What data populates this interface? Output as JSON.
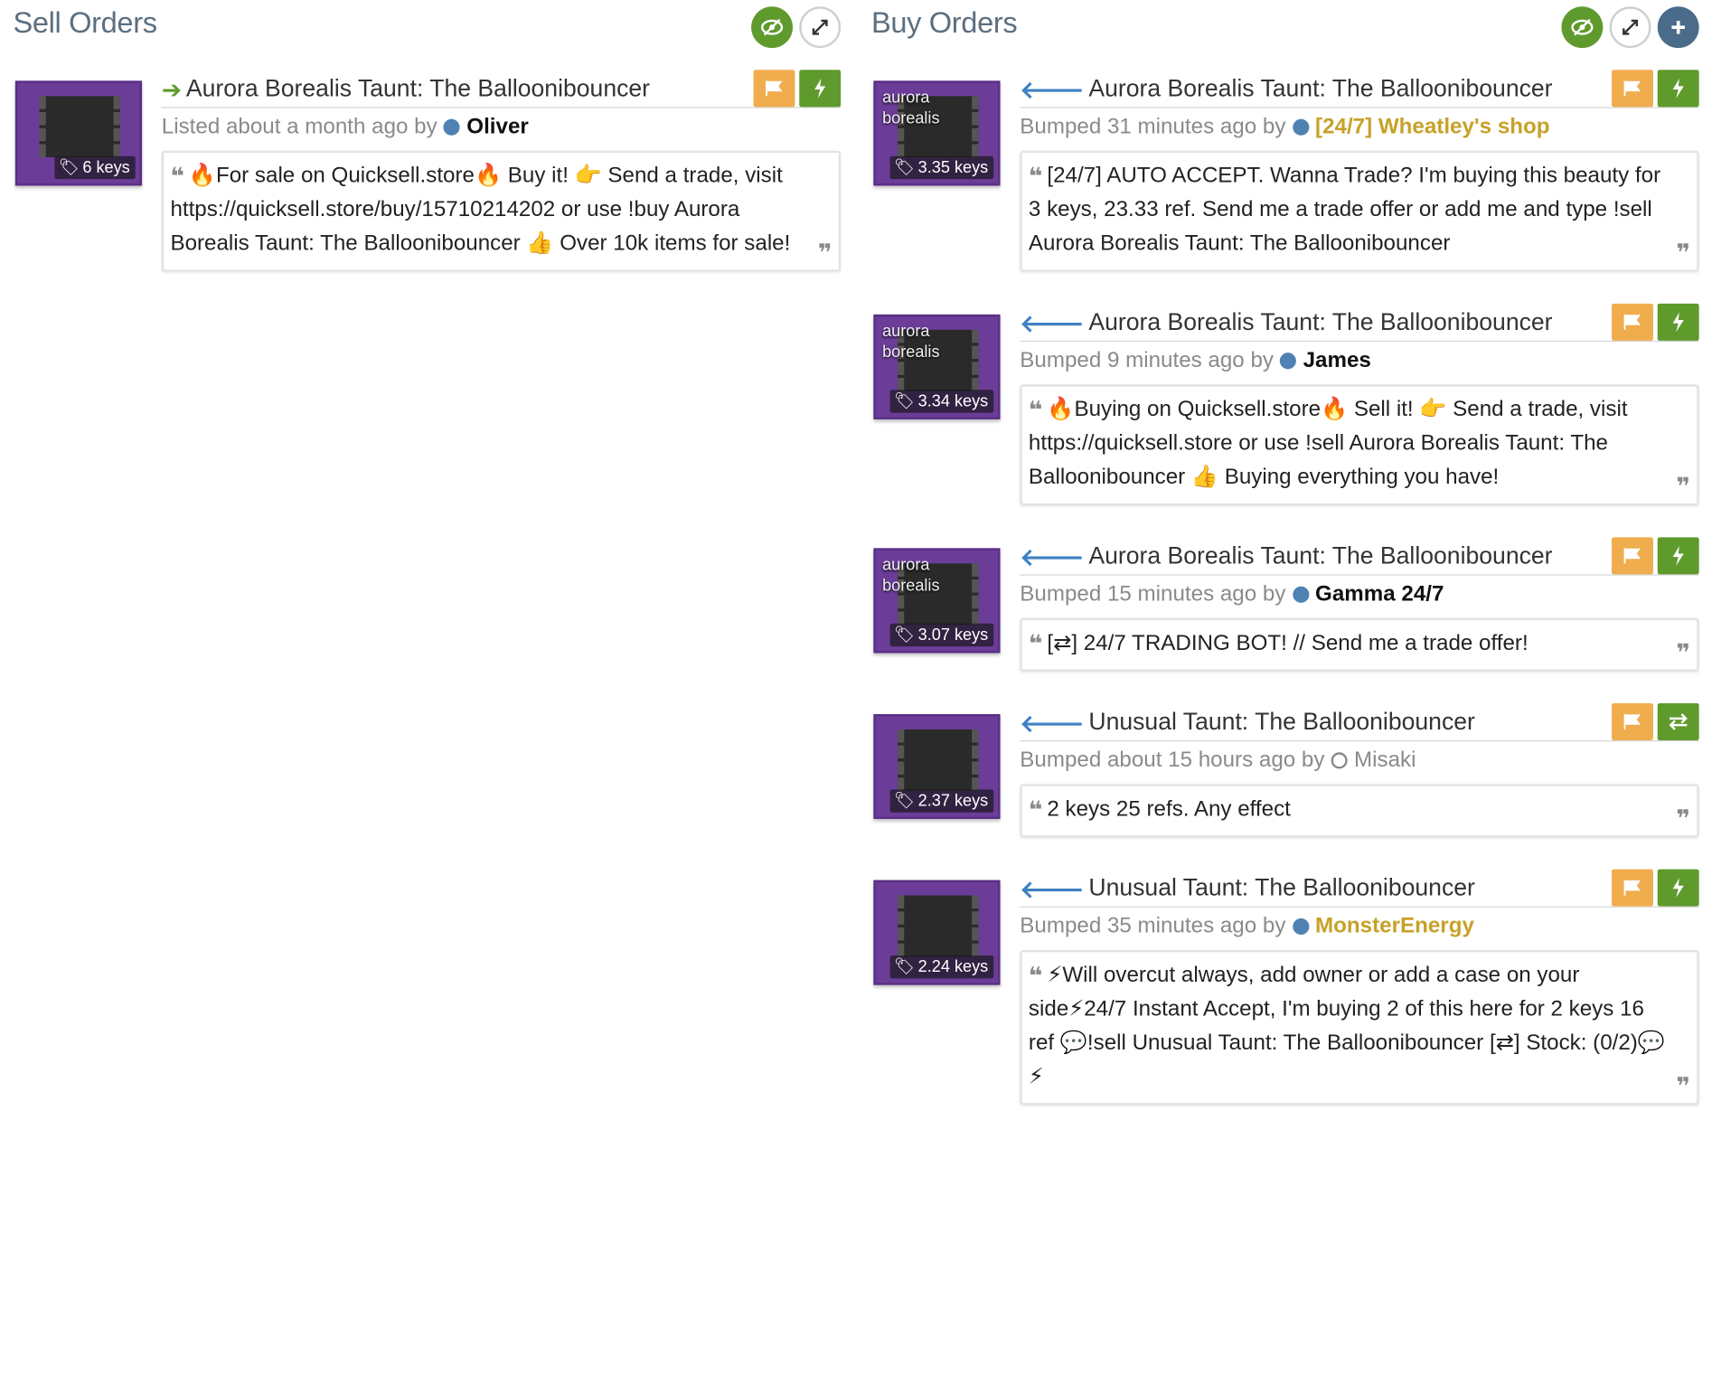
{
  "sell": {
    "title": "Sell Orders",
    "listings": [
      {
        "name": "Aurora Borealis Taunt: The Balloonibouncer",
        "price": "6 keys",
        "meta_prefix": "Listed about a month ago by",
        "user": "Oliver",
        "message": "🔥For sale on Quicksell.store🔥 Buy it! 👉 Send a trade, visit https://quicksell.store/buy/15710214202 or use !buy Aurora Borealis Taunt: The Balloonibouncer 👍 Over 10k items for sale!"
      }
    ]
  },
  "buy": {
    "title": "Buy Orders",
    "listings": [
      {
        "name": "Aurora Borealis Taunt: The Balloonibouncer",
        "overlay": "aurora borealis",
        "price": "3.35 keys",
        "meta_prefix": "Bumped 31 minutes ago by",
        "user": "[24/7] Wheatley's shop",
        "message": "[24/7] AUTO ACCEPT. Wanna Trade? I'm buying this beauty for 3 keys, 23.33 ref. Send me a trade offer or add me and type !sell Aurora Borealis Taunt: The Balloonibouncer"
      },
      {
        "name": "Aurora Borealis Taunt: The Balloonibouncer",
        "overlay": "aurora borealis",
        "price": "3.34 keys",
        "meta_prefix": "Bumped 9 minutes ago by",
        "user": "James",
        "message": "🔥Buying on Quicksell.store🔥 Sell it! 👉 Send a trade, visit https://quicksell.store or use !sell Aurora Borealis Taunt: The Balloonibouncer 👍 Buying everything you have!"
      },
      {
        "name": "Aurora Borealis Taunt: The Balloonibouncer",
        "overlay": "aurora borealis",
        "price": "3.07 keys",
        "meta_prefix": "Bumped 15 minutes ago by",
        "user": "Gamma 24/7",
        "message": "[⇄] 24/7 TRADING BOT! // Send me a trade offer!"
      },
      {
        "name": "Unusual Taunt: The Balloonibouncer",
        "price": "2.37 keys",
        "meta_prefix": "Bumped about 15 hours ago by",
        "user": "Misaki",
        "message": "2 keys 25 refs. Any effect"
      },
      {
        "name": "Unusual Taunt: The Balloonibouncer",
        "price": "2.24 keys",
        "meta_prefix": "Bumped 35 minutes ago by",
        "user": "MonsterEnergy",
        "message": "⚡Will overcut always, add owner or add a case on your side⚡24/7 Instant Accept, I'm buying 2 of this here for 2 keys 16 ref 💬!sell Unusual Taunt: The Balloonibouncer [⇄] Stock: (0/2)💬⚡"
      }
    ]
  }
}
